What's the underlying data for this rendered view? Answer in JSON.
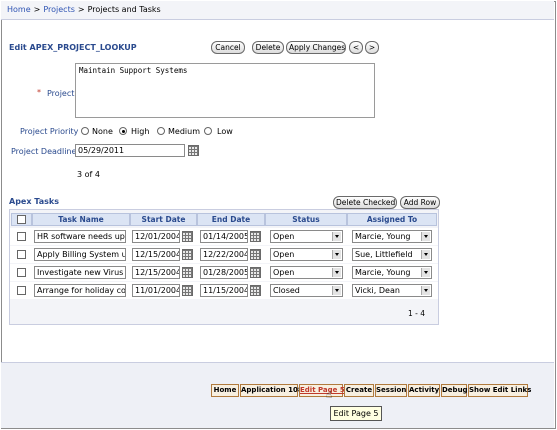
{
  "breadcrumb": {
    "home": "Home",
    "projects": "Projects",
    "current": "Projects and Tasks",
    "separator": ">"
  },
  "edit_form": {
    "title": "Edit APEX_PROJECT_LOOKUP",
    "buttons": {
      "cancel": "Cancel",
      "delete": "Delete",
      "apply": "Apply Changes",
      "prev": "<",
      "next": ">"
    },
    "project_label": "Project",
    "project_value": "Maintain Support Systems",
    "priority_label": "Project Priority",
    "priority_options": [
      "None",
      "High",
      "Medium",
      "Low"
    ],
    "priority_selected": "High",
    "deadline_label": "Project Deadline",
    "deadline_value": "05/29/2011",
    "record_count": "3 of 4"
  },
  "tasks": {
    "title": "Apex Tasks",
    "buttons": {
      "delete_checked": "Delete Checked",
      "add_row": "Add Row"
    },
    "columns": [
      "Task Name",
      "Start Date",
      "End Date",
      "Status",
      "Assigned To"
    ],
    "rows": [
      {
        "task": "HR software needs up",
        "start": "12/01/2004",
        "end": "01/14/2005",
        "status": "Open",
        "assigned": "Marcie, Young"
      },
      {
        "task": "Apply Billing System u",
        "start": "12/15/2004",
        "end": "12/22/2004",
        "status": "Open",
        "assigned": "Sue, Littlefield"
      },
      {
        "task": "Investigate new Virus",
        "start": "12/15/2004",
        "end": "01/28/2005",
        "status": "Open",
        "assigned": "Marcie, Young"
      },
      {
        "task": "Arrange for holiday co",
        "start": "11/01/2004",
        "end": "11/15/2004",
        "status": "Closed",
        "assigned": "Vicki, Dean"
      }
    ],
    "pagination": "1 - 4"
  },
  "developer_toolbar": {
    "links": [
      "Home",
      "Application 108",
      "Edit Page 5",
      "Create",
      "Session",
      "Activity",
      "Debug",
      "Show Edit Links"
    ],
    "tooltip": "Edit Page 5"
  }
}
